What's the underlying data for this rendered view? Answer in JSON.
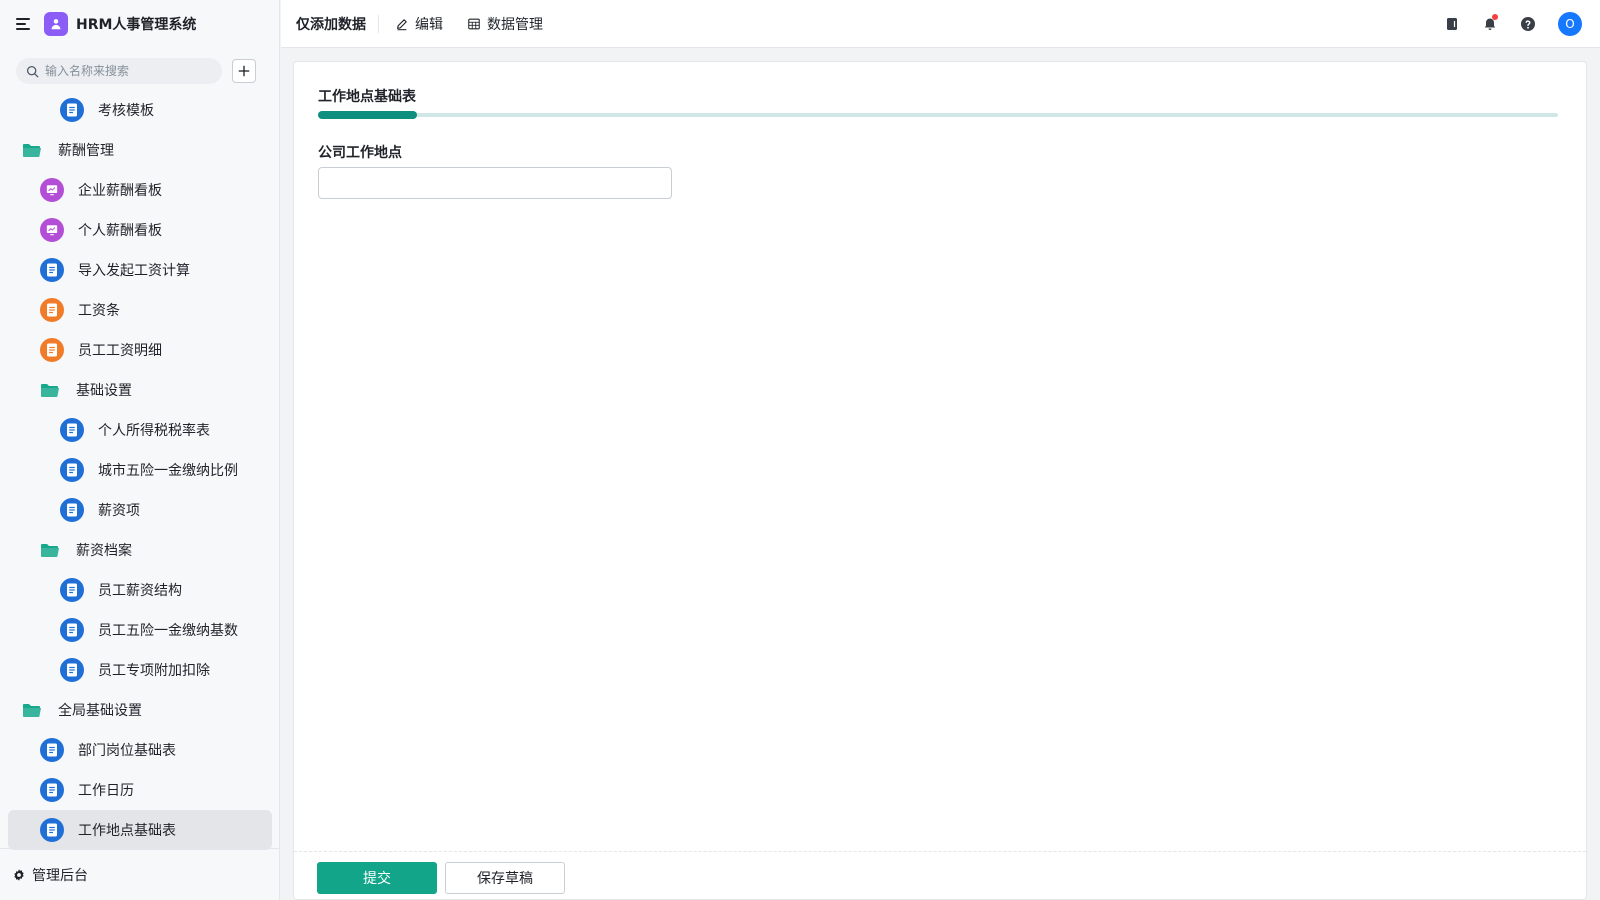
{
  "app": {
    "title": "HRM人事管理系统",
    "logo_color": "#8b5cf6"
  },
  "search": {
    "placeholder": "输入名称来搜索"
  },
  "sidebar": {
    "items": [
      {
        "label": "考核模板",
        "kind": "doc",
        "color": "#1f6fd6",
        "level": 3,
        "active": false
      },
      {
        "label": "薪酬管理",
        "kind": "folder",
        "color": "#16a98b",
        "level": 1,
        "active": false
      },
      {
        "label": "企业薪酬看板",
        "kind": "dashboard",
        "color": "#b34fd6",
        "level": 2,
        "active": false
      },
      {
        "label": "个人薪酬看板",
        "kind": "dashboard",
        "color": "#b34fd6",
        "level": 2,
        "active": false
      },
      {
        "label": "导入发起工资计算",
        "kind": "doc",
        "color": "#1f6fd6",
        "level": 2,
        "active": false
      },
      {
        "label": "工资条",
        "kind": "doc",
        "color": "#f07c2a",
        "level": 2,
        "active": false
      },
      {
        "label": "员工工资明细",
        "kind": "doc",
        "color": "#f07c2a",
        "level": 2,
        "active": false
      },
      {
        "label": "基础设置",
        "kind": "folder",
        "color": "#16a98b",
        "level": 2,
        "active": false
      },
      {
        "label": "个人所得税税率表",
        "kind": "doc",
        "color": "#1f6fd6",
        "level": 3,
        "active": false
      },
      {
        "label": "城市五险一金缴纳比例",
        "kind": "doc",
        "color": "#1f6fd6",
        "level": 3,
        "active": false
      },
      {
        "label": "薪资项",
        "kind": "doc",
        "color": "#1f6fd6",
        "level": 3,
        "active": false
      },
      {
        "label": "薪资档案",
        "kind": "folder",
        "color": "#16a98b",
        "level": 2,
        "active": false
      },
      {
        "label": "员工薪资结构",
        "kind": "doc",
        "color": "#1f6fd6",
        "level": 3,
        "active": false
      },
      {
        "label": "员工五险一金缴纳基数",
        "kind": "doc",
        "color": "#1f6fd6",
        "level": 3,
        "active": false
      },
      {
        "label": "员工专项附加扣除",
        "kind": "doc",
        "color": "#1f6fd6",
        "level": 3,
        "active": false
      },
      {
        "label": "全局基础设置",
        "kind": "folder",
        "color": "#16a98b",
        "level": 1,
        "active": false
      },
      {
        "label": "部门岗位基础表",
        "kind": "doc",
        "color": "#1f6fd6",
        "level": 2,
        "active": false
      },
      {
        "label": "工作日历",
        "kind": "doc",
        "color": "#1f6fd6",
        "level": 2,
        "active": false
      },
      {
        "label": "工作地点基础表",
        "kind": "doc",
        "color": "#1f6fd6",
        "level": 2,
        "active": true
      }
    ],
    "footer_label": "管理后台"
  },
  "topbar": {
    "title": "仅添加数据",
    "edit_label": "编辑",
    "data_manage_label": "数据管理",
    "avatar_letter": "O"
  },
  "form": {
    "tab_title": "工作地点基础表",
    "progress_fraction": 0.08,
    "field_label": "公司工作地点",
    "field_value": "",
    "submit_label": "提交",
    "draft_label": "保存草稿",
    "accent_color": "#12a58a"
  }
}
